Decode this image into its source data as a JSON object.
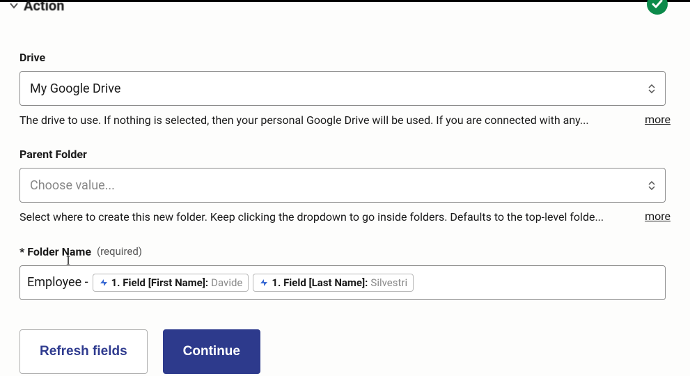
{
  "header": {
    "title": "Action"
  },
  "fields": {
    "drive": {
      "label": "Drive",
      "value": "My Google Drive",
      "help": "The drive to use. If nothing is selected, then your personal Google Drive will be used. If you are connected with any...",
      "more": "more"
    },
    "parentFolder": {
      "label": "Parent Folder",
      "placeholder": "Choose value...",
      "help": "Select where to create this new folder. Keep clicking the dropdown to go inside folders. Defaults to the top-level folde...",
      "more": "more"
    },
    "folderName": {
      "asterisk": "*",
      "label": "Folder Name",
      "hint": "(required)",
      "textPrefix": "Employee - ",
      "pills": [
        {
          "label": "1. Field [First Name]: ",
          "value": "Davide"
        },
        {
          "label": "1. Field [Last Name]: ",
          "value": "Silvestri"
        }
      ]
    }
  },
  "buttons": {
    "refresh": "Refresh fields",
    "continue": "Continue"
  }
}
